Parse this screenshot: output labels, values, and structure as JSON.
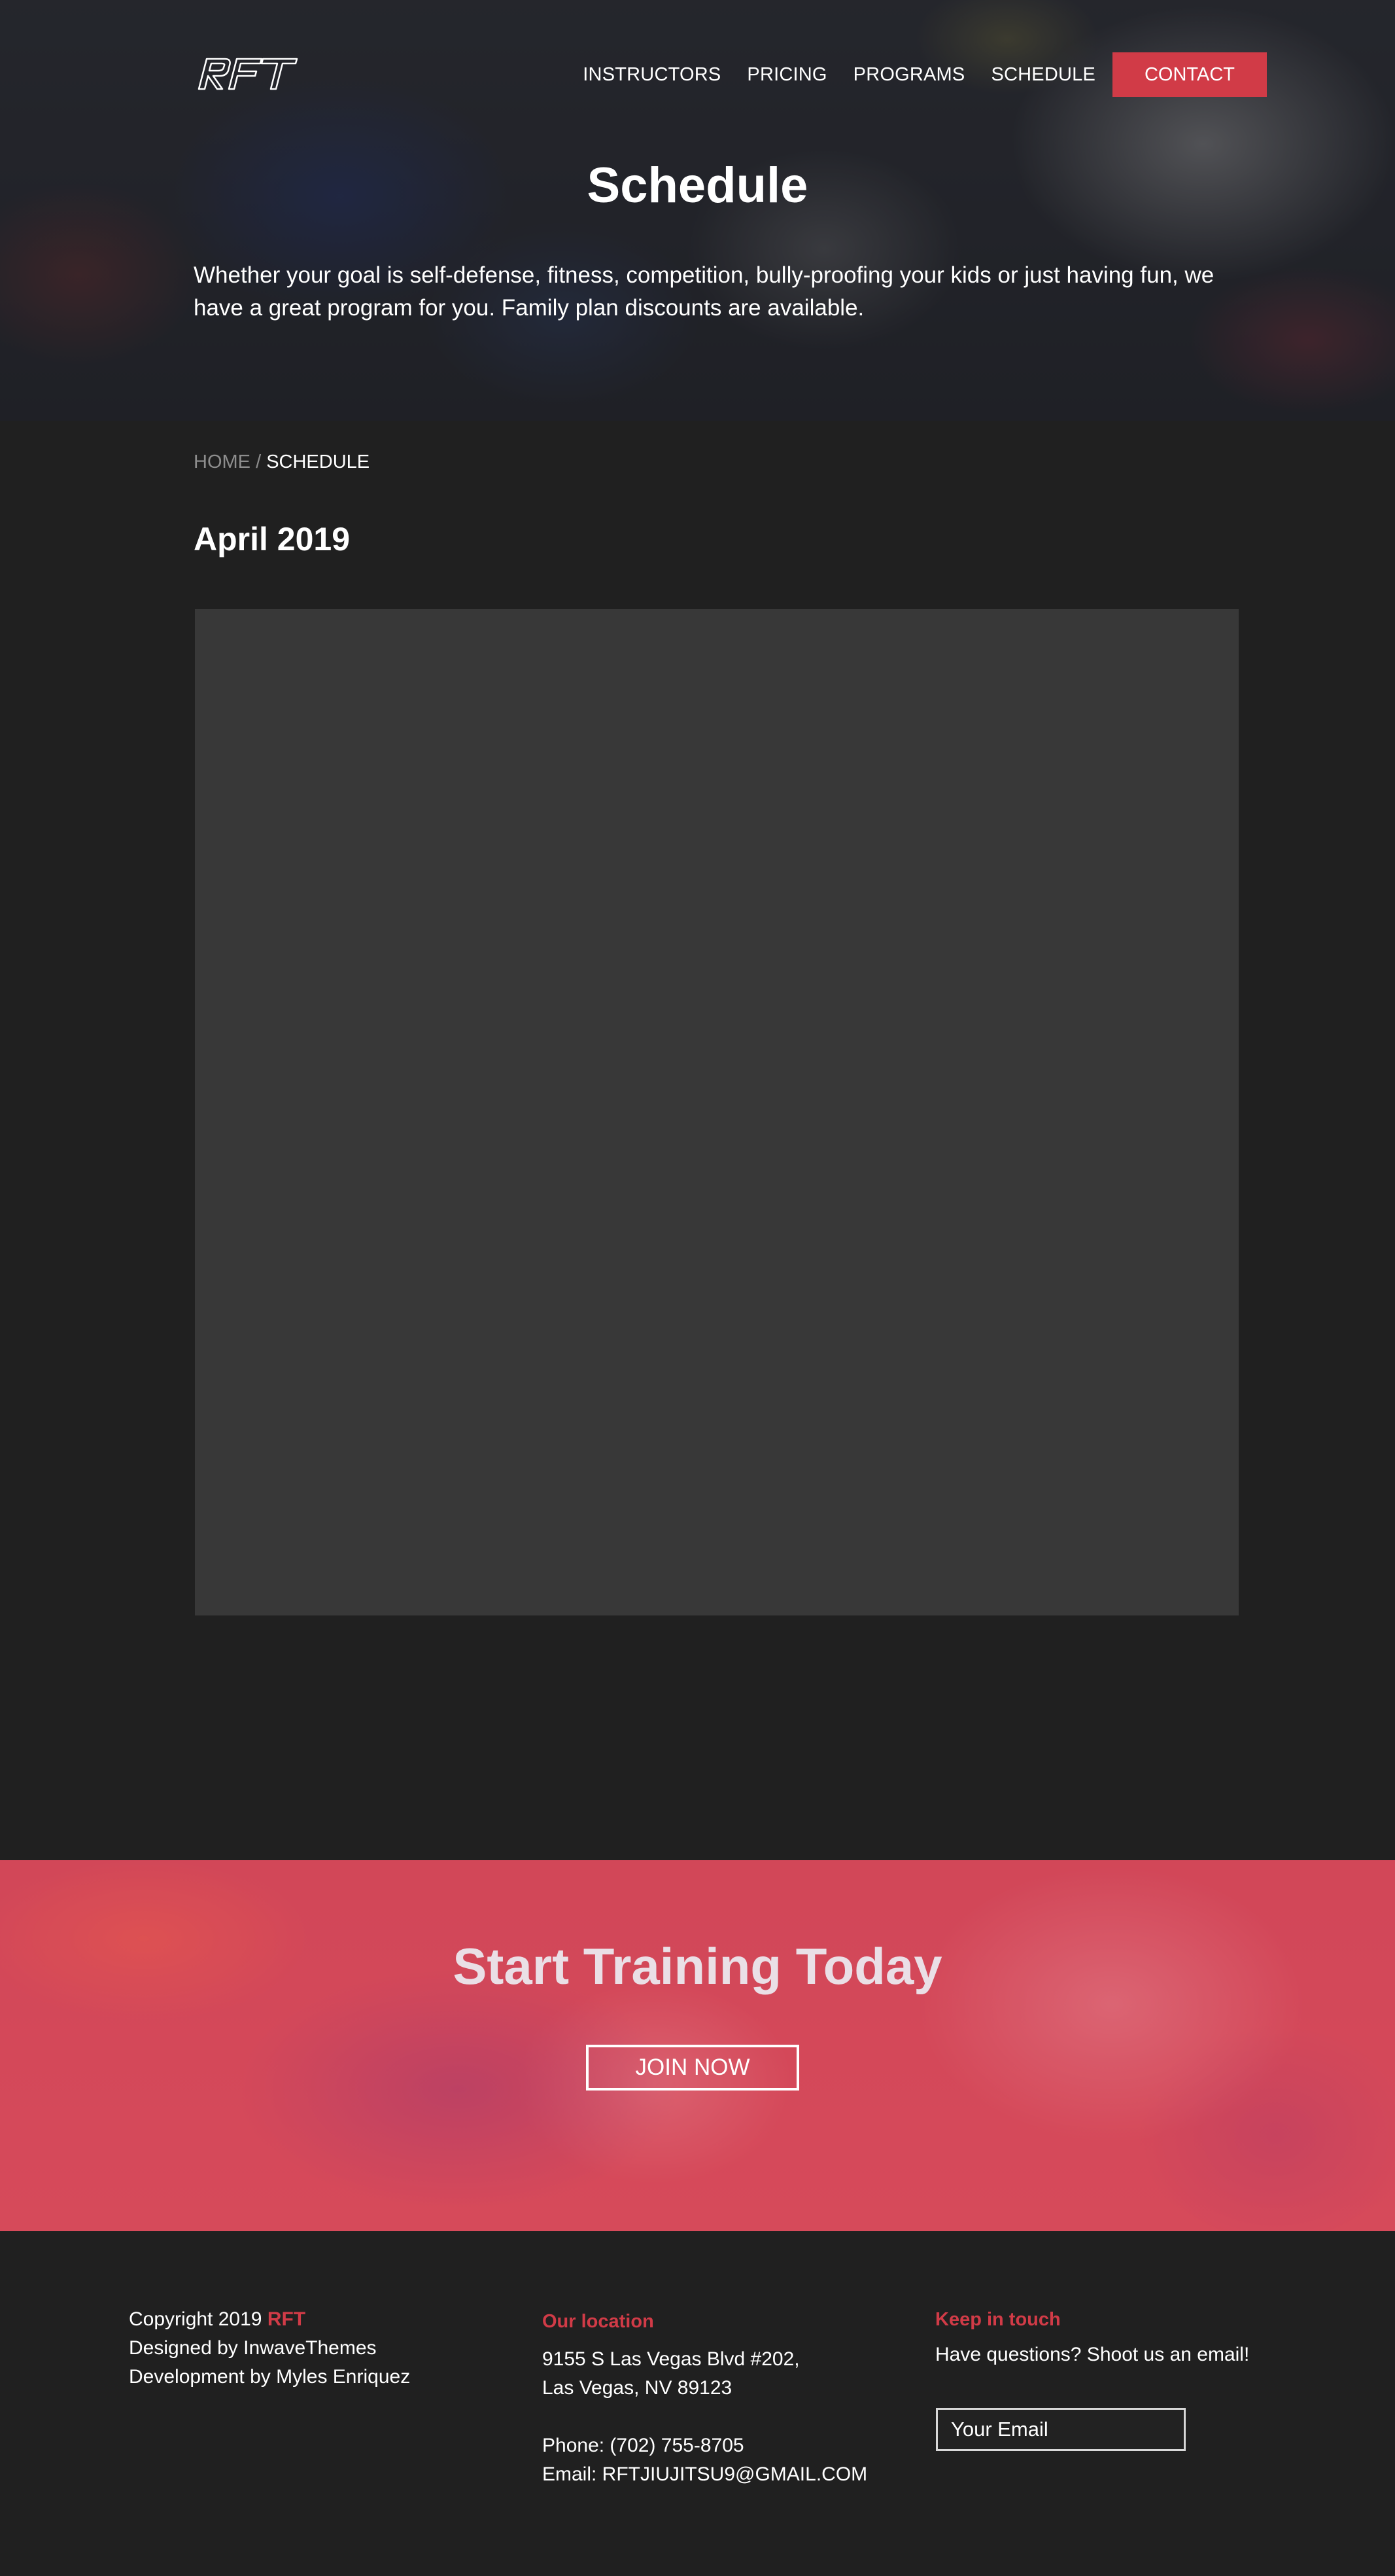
{
  "brand": {
    "logo_text": "RFT",
    "accent_color": "#d13b47"
  },
  "nav": {
    "items": [
      "INSTRUCTORS",
      "PRICING",
      "PROGRAMS",
      "SCHEDULE"
    ],
    "contact_label": "CONTACT"
  },
  "hero": {
    "title": "Schedule",
    "text": "Whether your goal is self-defense, fitness, competition, bully-proofing your kids or just having fun, we have a great program for you. Family plan discounts are available."
  },
  "breadcrumb": {
    "home": "HOME",
    "separator": "/",
    "current": "SCHEDULE"
  },
  "schedule": {
    "month_title": "April 2019"
  },
  "cta": {
    "title": "Start Training Today",
    "button_label": "JOIN NOW"
  },
  "footer": {
    "copyright_prefix": "Copyright 2019",
    "copyright_brand": "RFT",
    "designed_by": "Designed by InwaveThemes",
    "development_by": "Development by Myles Enriquez",
    "location_heading": "Our location",
    "address_line1": "9155 S Las Vegas Blvd #202,",
    "address_line2": "Las Vegas, NV 89123",
    "phone": "Phone: (702) 755-8705",
    "email": "Email: RFTJIUJITSU9@GMAIL.COM",
    "contact_heading": "Keep in touch",
    "contact_text": "Have questions? Shoot us an email!",
    "email_placeholder": "Your Email"
  }
}
